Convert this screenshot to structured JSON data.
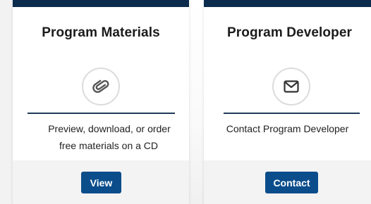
{
  "cards": [
    {
      "title": "Program Materials",
      "icon": "paperclip-icon",
      "description_line1": "Preview, download, or order",
      "description_line2": "free materials on a CD",
      "button_label": "View"
    },
    {
      "title": "Program Developer",
      "icon": "envelope-icon",
      "description_line1": "Contact Program Developer",
      "description_line2": "",
      "button_label": "Contact"
    }
  ],
  "colors": {
    "header_bar": "#0b2c4d",
    "button_bg": "#0b4d8b",
    "divider": "#1f3a5a",
    "icon_stroke": "#555555"
  }
}
